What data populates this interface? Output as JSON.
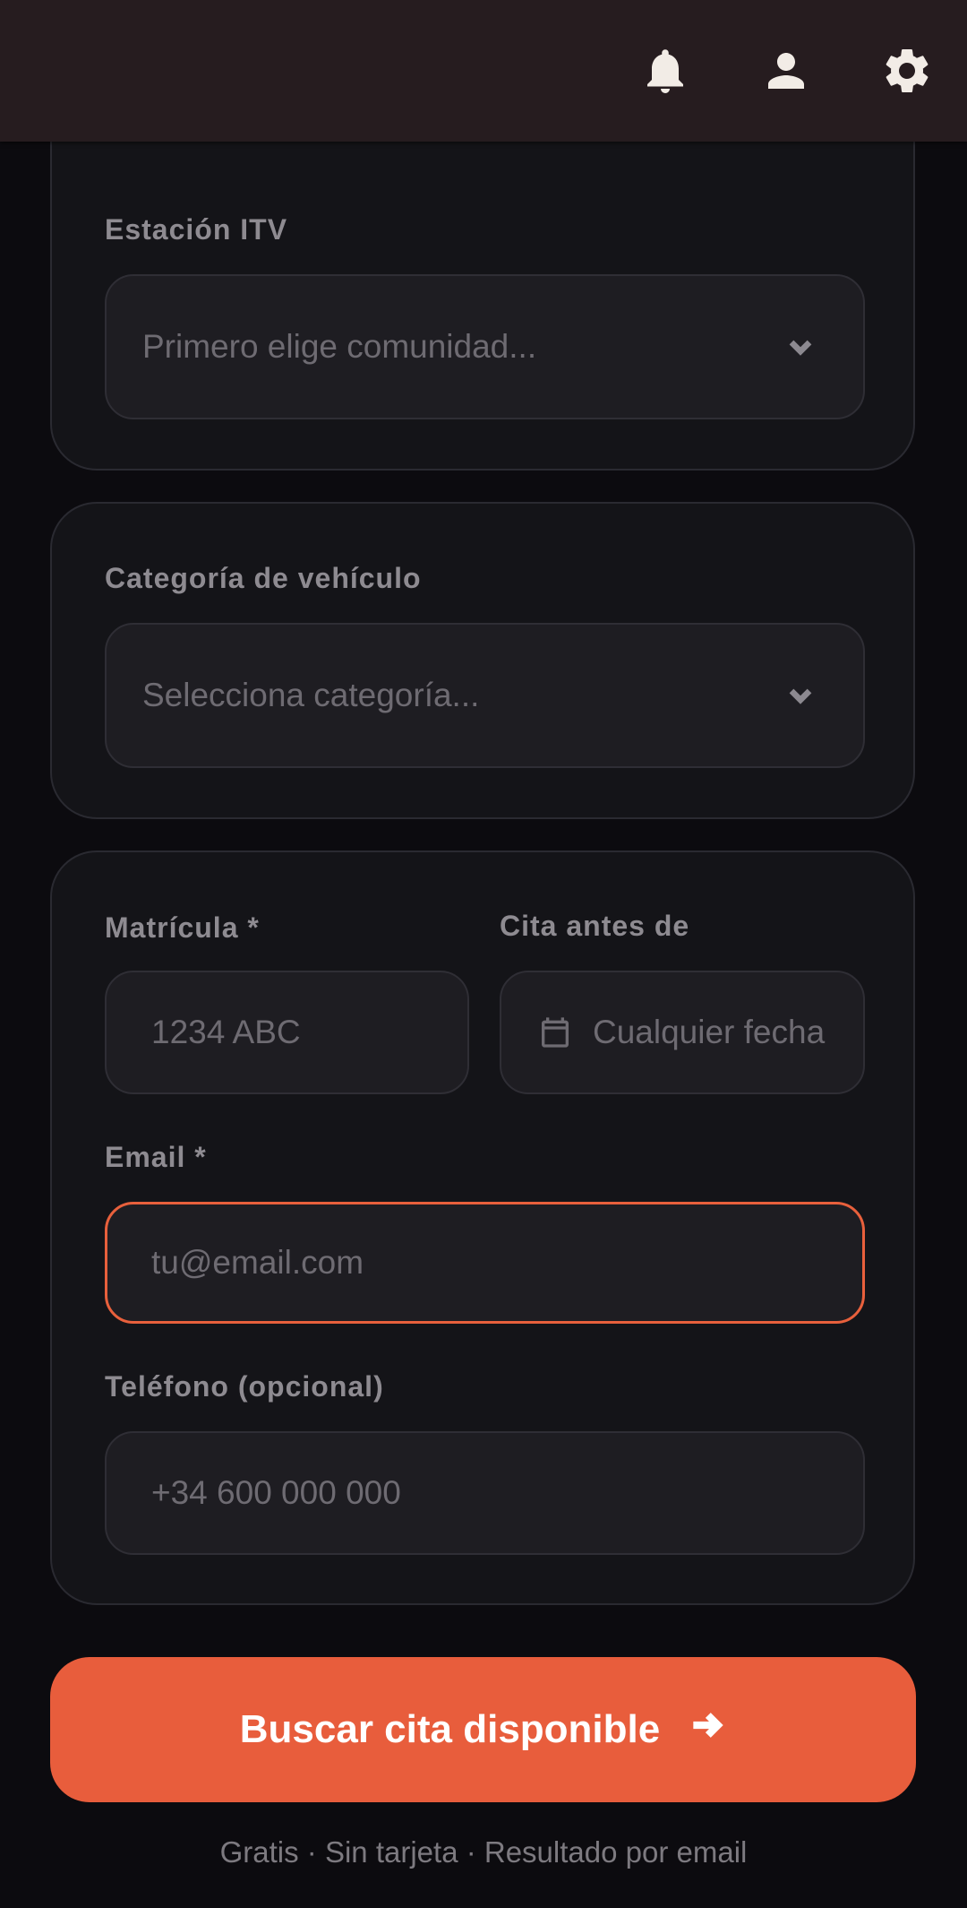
{
  "colors": {
    "background": "#0c0b0f",
    "card": "#141418",
    "field": "#1e1d22",
    "accent": "#e85d3c",
    "topbar": "#261c1f"
  },
  "topbar": {
    "icons": [
      "bell-icon",
      "person-icon",
      "gear-icon"
    ]
  },
  "form": {
    "station": {
      "label": "Estación ITV",
      "placeholder": "Primero elige comunidad..."
    },
    "category": {
      "label": "Categoría de vehículo",
      "placeholder": "Selecciona categoría..."
    },
    "plate": {
      "label": "Matrícula *",
      "placeholder": "1234 ABC"
    },
    "date": {
      "label": "Cita antes de",
      "placeholder": "Cualquier fecha"
    },
    "email": {
      "label": "Email *",
      "placeholder": "tu@email.com"
    },
    "phone": {
      "label": "Teléfono (opcional)",
      "placeholder": "+34 600 000 000"
    }
  },
  "cta": {
    "label": "Buscar cita disponible"
  },
  "footnote": "Gratis · Sin tarjeta · Resultado por email"
}
